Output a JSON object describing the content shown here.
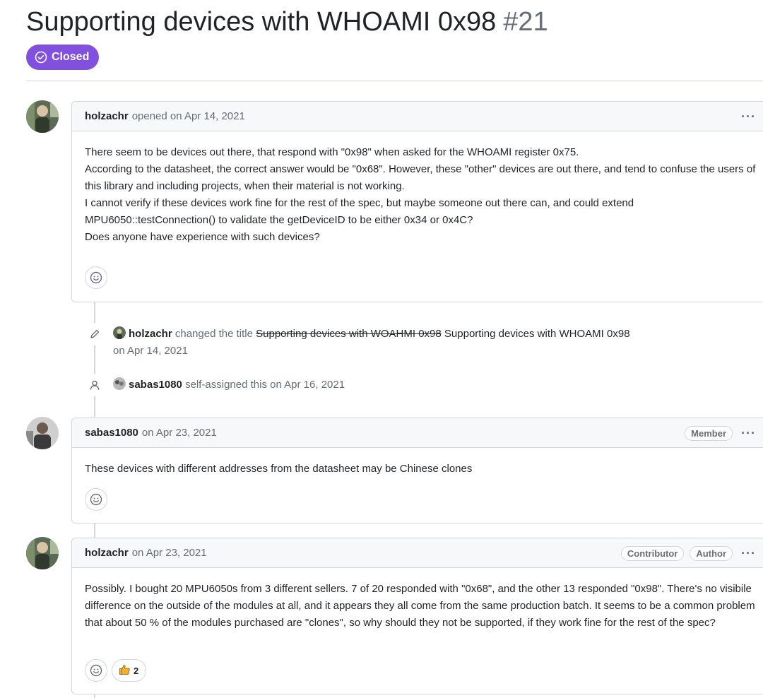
{
  "issue": {
    "title": "Supporting devices with WHOAMI 0x98",
    "number": "#21",
    "state": "Closed"
  },
  "comments": [
    {
      "author": "holzachr",
      "meta": "opened on Apr 14, 2021",
      "menu": "···",
      "body": [
        "There seem to be devices out there, that respond with \"0x98\" when asked for the WHOAMI register 0x75.",
        "According to the datasheet, the correct answer would be \"0x68\". However, these \"other\" devices are out there, and tend to confuse the users of this library and including projects, when their material is not working.",
        "I cannot verify if these devices work fine for the rest of the spec, but maybe someone out there can, and could extend MPU6050::testConnection() to validate the getDeviceID to be either 0x34 or 0x4C?",
        "Does anyone have experience with such devices?"
      ]
    },
    {
      "author": "sabas1080",
      "meta": "on Apr 23, 2021",
      "badges": [
        "Member"
      ],
      "menu": "···",
      "body": [
        "These devices with different addresses from the datasheet may be Chinese clones"
      ]
    },
    {
      "author": "holzachr",
      "meta": "on Apr 23, 2021",
      "badges": [
        "Contributor",
        "Author"
      ],
      "menu": "···",
      "body": [
        "Possibly. I bought 20 MPU6050s from 3 different sellers. 7 of 20 responded with \"0x68\", and the other 13 responded \"0x98\". There's no visibile difference on the outside of the modules at all, and it appears they all come from the same production batch. It seems to be a common problem that about 50 % of the modules purchased are \"clones\", so why should they not be supported, if they work fine for the rest of the spec?"
      ],
      "reactions": [
        {
          "icon": "thumbs-up-icon",
          "count": "2"
        }
      ]
    }
  ],
  "events": [
    {
      "icon": "pencil-icon",
      "actor": "holzachr",
      "action": "changed the title",
      "old_title": "Supporting devices with WOAHMI 0x98",
      "new_title": "Supporting devices with WHOAMI 0x98",
      "date": "on Apr 14, 2021"
    },
    {
      "icon": "person-icon",
      "actor": "sabas1080",
      "action": "self-assigned this on Apr 16, 2021"
    }
  ],
  "colors": {
    "closed": "#8250df",
    "border": "#d0d7de",
    "muted": "#656d76",
    "header_bg": "#f6f8fa"
  }
}
